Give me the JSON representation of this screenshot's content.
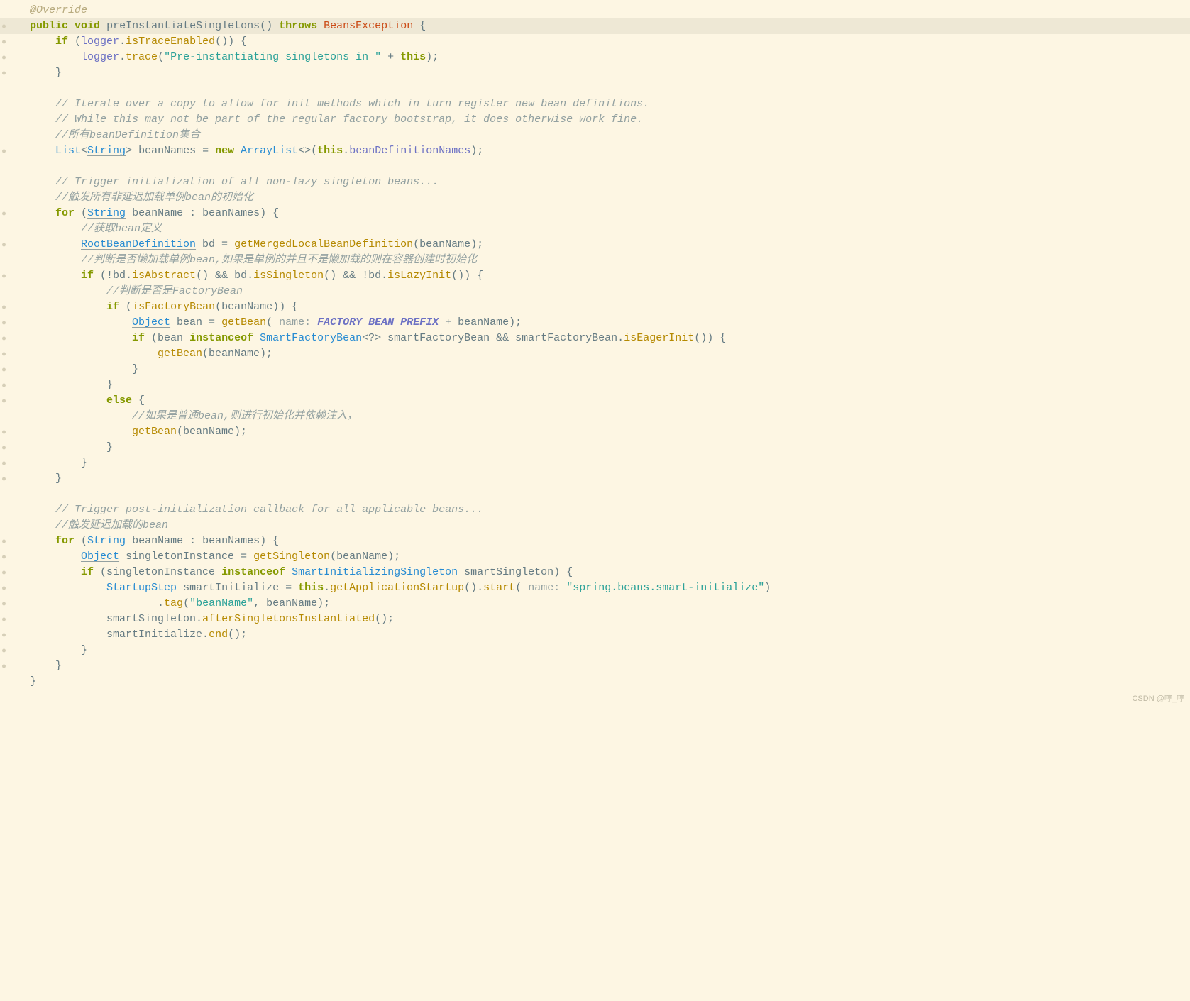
{
  "code": {
    "override": "@Override",
    "sig_public": "public",
    "sig_void": "void",
    "sig_name": "preInstantiateSingletons",
    "sig_parens": "()",
    "sig_throws": "throws",
    "sig_exception": "BeansException",
    "sig_brace": " {",
    "if1_if": "if",
    "if1_logger": "logger",
    "if1_isTraceEnabled": "isTraceEnabled",
    "if1_tail": "()) {",
    "trace_logger": "logger",
    "trace_method": "trace",
    "trace_str": "\"Pre-instantiating singletons in \"",
    "trace_plus": " + ",
    "trace_this": "this",
    "trace_tail": ");",
    "close_brace": "}",
    "c1": "// Iterate over a copy to allow for init methods which in turn register new bean definitions.",
    "c2": "// While this may not be part of the regular factory bootstrap, it does otherwise work fine.",
    "c3": "//所有beanDefinition集合",
    "list_type": "List",
    "list_lt": "<",
    "list_string": "String",
    "list_gt": ">",
    "list_var": " beanNames = ",
    "list_new": "new",
    "list_arraylist": " ArrayList",
    "list_diamond": "<>(",
    "list_this": "this",
    "list_dot": ".",
    "list_field": "beanDefinitionNames",
    "list_tail": ");",
    "c4": "// Trigger initialization of all non-lazy singleton beans...",
    "c5": "//触发所有非延迟加载单例bean的初始化",
    "for1_for": "for",
    "for1_open": " (",
    "for1_string": "String",
    "for1_rest": " beanName : beanNames) {",
    "c6": "//获取bean定义",
    "rbd_type": "RootBeanDefinition",
    "rbd_var": " bd = ",
    "rbd_method": "getMergedLocalBeanDefinition",
    "rbd_tail": "(beanName);",
    "c7": "//判断是否懒加载单例bean,如果是单例的并且不是懒加载的则在容器创建时初始化",
    "if2_if": "if",
    "if2_open": " (!bd.",
    "if2_isAbstract": "isAbstract",
    "if2_mid1": "() && bd.",
    "if2_isSingleton": "isSingleton",
    "if2_mid2": "() && !bd.",
    "if2_isLazyInit": "isLazyInit",
    "if2_tail": "()) {",
    "c8": "//判断是否是FactoryBean",
    "if3_if": "if",
    "if3_open": " (",
    "if3_isFactoryBean": "isFactoryBean",
    "if3_tail": "(beanName)) {",
    "obj_type": "Object",
    "obj_var": " bean = ",
    "obj_getBean": "getBean",
    "obj_open": "(",
    "obj_hint": " name: ",
    "obj_const": "FACTORY_BEAN_PREFIX",
    "obj_tail": " + beanName);",
    "if4_if": "if",
    "if4_open": " (bean ",
    "if4_instanceof": "instanceof",
    "if4_sfb": " SmartFactoryBean",
    "if4_wild": "<?>",
    "if4_var": " smartFactoryBean && smartFactoryBean.",
    "if4_eager": "isEagerInit",
    "if4_tail": "()) {",
    "gb_method": "getBean",
    "gb_tail": "(beanName);",
    "else_kw": "else",
    "else_brace": " {",
    "c9": "//如果是普通bean,则进行初始化并依赖注入，",
    "gb2_method": "getBean",
    "gb2_tail": "(beanName);",
    "c10": "// Trigger post-initialization callback for all applicable beans...",
    "c11": "//触发延迟加载的bean",
    "for2_for": "for",
    "for2_string": "String",
    "for2_rest": " beanName : beanNames) {",
    "si_type": "Object",
    "si_var": " singletonInstance = ",
    "si_method": "getSingleton",
    "si_tail": "(beanName);",
    "if5_if": "if",
    "if5_open": " (singletonInstance ",
    "if5_instanceof": "instanceof",
    "if5_type": " SmartInitializingSingleton",
    "if5_tail": " smartSingleton) {",
    "ss_type": "StartupStep",
    "ss_var": " smartInitialize = ",
    "ss_this": "this",
    "ss_dot": ".",
    "ss_gas": "getApplicationStartup",
    "ss_mid": "().",
    "ss_start": "start",
    "ss_open": "(",
    "ss_hint": " name: ",
    "ss_str": "\"spring.beans.smart-initialize\"",
    "ss_tail": ")",
    "tag_dot": ".",
    "tag_method": "tag",
    "tag_open": "(",
    "tag_str": "\"beanName\"",
    "tag_tail": ", beanName);",
    "asi_var": "smartSingleton.",
    "asi_method": "afterSingletonsInstantiated",
    "asi_tail": "();",
    "end_var": "smartInitialize.",
    "end_method": "end",
    "end_tail": "();"
  },
  "watermark": "CSDN @哼_哼"
}
